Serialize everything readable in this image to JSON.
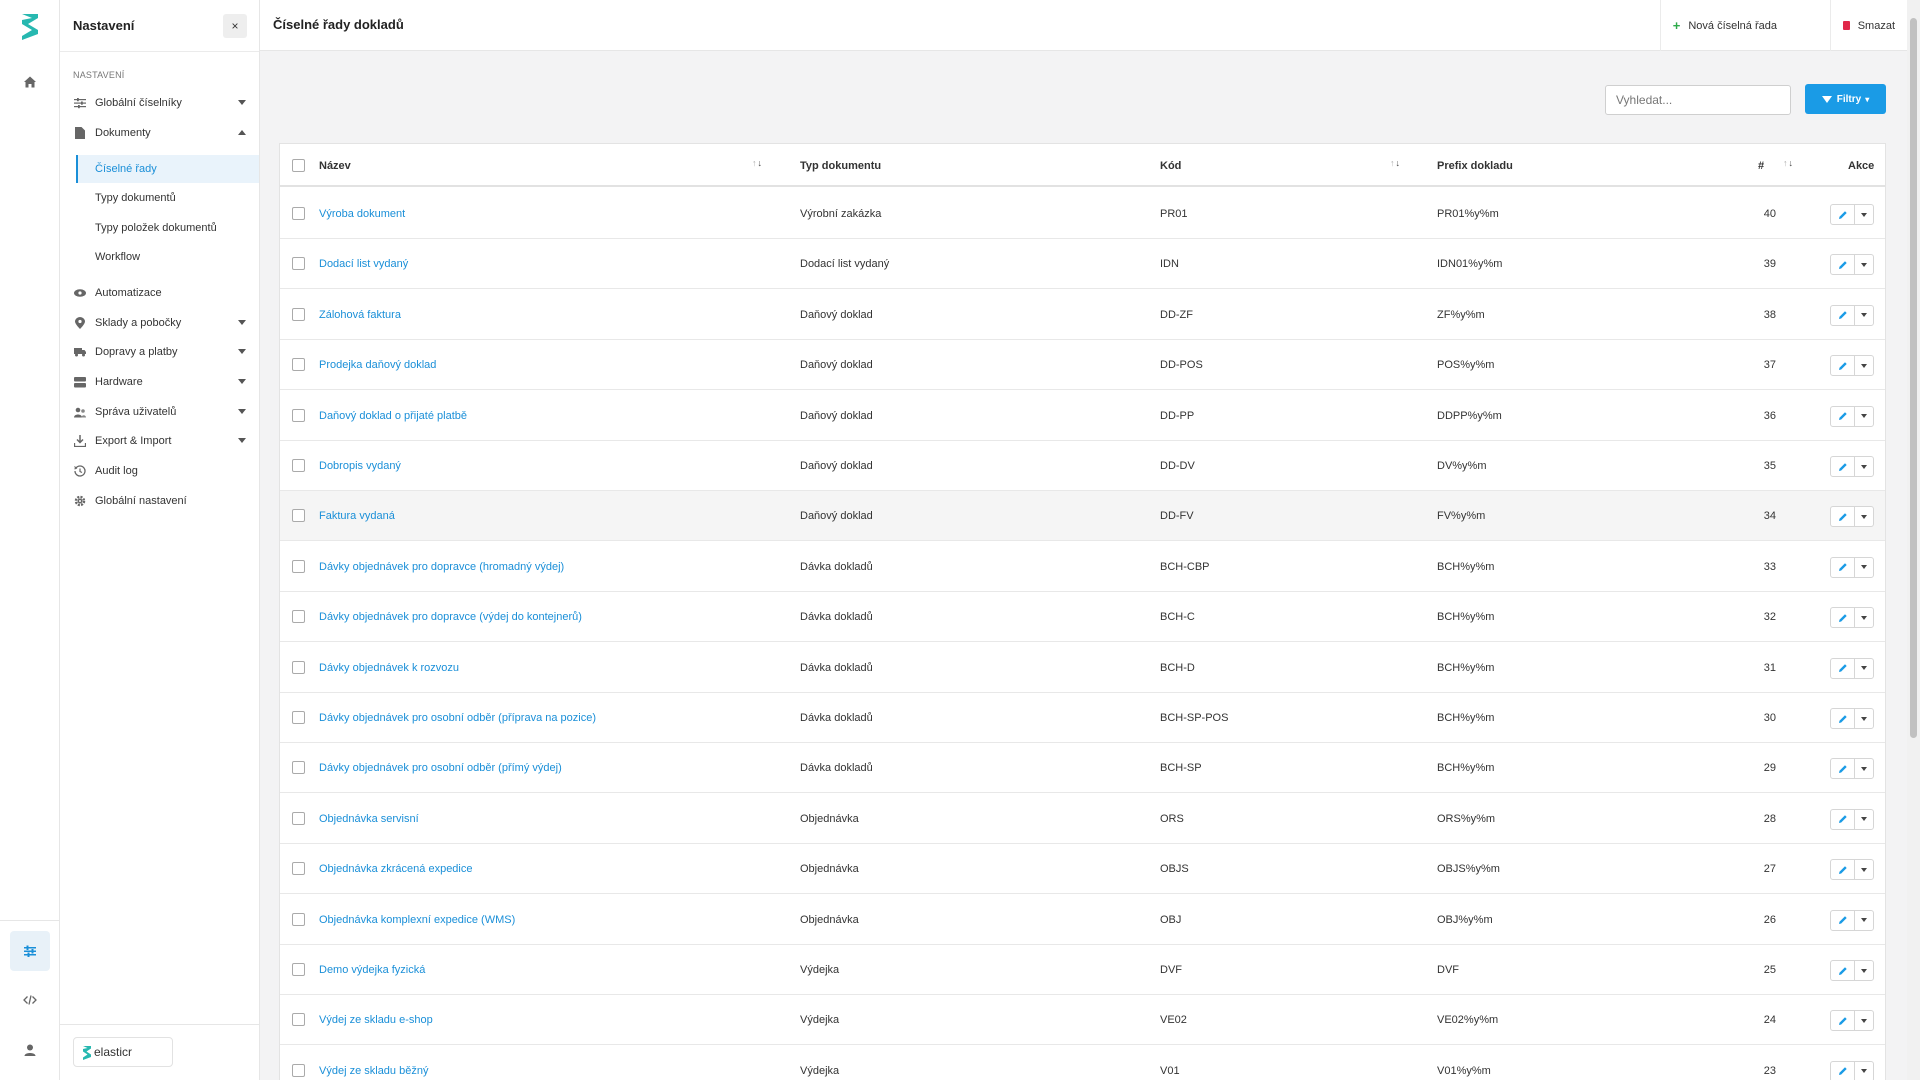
{
  "app": {
    "accent": "#1a9be6",
    "brand_color": "#27b8b0",
    "brand_name": "elasticr"
  },
  "rail": {
    "icons": [
      "logo-icon",
      "home-icon",
      "sliders-icon",
      "code-icon",
      "user-icon"
    ]
  },
  "sidebar": {
    "title": "Nastavení",
    "close_label": "×",
    "section_label": "NASTAVENÍ",
    "items": [
      {
        "label": "Globální číselníky",
        "icon": "sliders-icon"
      },
      {
        "label": "Dokumenty",
        "icon": "document-icon"
      },
      {
        "label": "Automatizace",
        "icon": "eye-icon"
      },
      {
        "label": "Sklady a pobočky",
        "icon": "pin-icon"
      },
      {
        "label": "Dopravy a platby",
        "icon": "truck-icon"
      },
      {
        "label": "Hardware",
        "icon": "server-icon"
      },
      {
        "label": "Správa uživatelů",
        "icon": "users-icon"
      },
      {
        "label": "Export & Import",
        "icon": "download-icon"
      },
      {
        "label": "Audit log",
        "icon": "history-icon"
      },
      {
        "label": "Globální nastavení",
        "icon": "gear-icon"
      }
    ],
    "sub_items": [
      {
        "label": "Číselné řady"
      },
      {
        "label": "Typy dokumentů"
      },
      {
        "label": "Typy položek dokumentů"
      },
      {
        "label": "Workflow"
      }
    ]
  },
  "header": {
    "title": "Číselné řady dokladů",
    "new_label": "Nová číselná řada",
    "delete_label": "Smazat"
  },
  "toolbar": {
    "search_placeholder": "Vyhledat...",
    "filter_label": "Filtry"
  },
  "table": {
    "columns": {
      "name": "Název",
      "doc_type": "Typ dokumentu",
      "code": "Kód",
      "prefix": "Prefix dokladu",
      "number": "#",
      "actions": "Akce"
    },
    "rows": [
      {
        "name": "Výroba dokument",
        "doc_type": "Výrobní zakázka",
        "code": "PR01",
        "prefix": "PR01%y%m",
        "number": "40"
      },
      {
        "name": "Dodací list vydaný",
        "doc_type": "Dodací list vydaný",
        "code": "IDN",
        "prefix": "IDN01%y%m",
        "number": "39"
      },
      {
        "name": "Zálohová faktura",
        "doc_type": "Daňový doklad",
        "code": "DD-ZF",
        "prefix": "ZF%y%m",
        "number": "38"
      },
      {
        "name": "Prodejka daňový doklad",
        "doc_type": "Daňový doklad",
        "code": "DD-POS",
        "prefix": "POS%y%m",
        "number": "37"
      },
      {
        "name": "Daňový doklad o přijaté platbě",
        "doc_type": "Daňový doklad",
        "code": "DD-PP",
        "prefix": "DDPP%y%m",
        "number": "36"
      },
      {
        "name": "Dobropis vydaný",
        "doc_type": "Daňový doklad",
        "code": "DD-DV",
        "prefix": "DV%y%m",
        "number": "35"
      },
      {
        "name": "Faktura vydaná",
        "doc_type": "Daňový doklad",
        "code": "DD-FV",
        "prefix": "FV%y%m",
        "number": "34"
      },
      {
        "name": "Dávky objednávek pro dopravce (hromadný výdej)",
        "doc_type": "Dávka dokladů",
        "code": "BCH-CBP",
        "prefix": "BCH%y%m",
        "number": "33"
      },
      {
        "name": "Dávky objednávek pro dopravce (výdej do kontejnerů)",
        "doc_type": "Dávka dokladů",
        "code": "BCH-C",
        "prefix": "BCH%y%m",
        "number": "32"
      },
      {
        "name": "Dávky objednávek k rozvozu",
        "doc_type": "Dávka dokladů",
        "code": "BCH-D",
        "prefix": "BCH%y%m",
        "number": "31"
      },
      {
        "name": "Dávky objednávek pro osobní odběr (příprava na pozice)",
        "doc_type": "Dávka dokladů",
        "code": "BCH-SP-POS",
        "prefix": "BCH%y%m",
        "number": "30"
      },
      {
        "name": "Dávky objednávek pro osobní odběr (přímý výdej)",
        "doc_type": "Dávka dokladů",
        "code": "BCH-SP",
        "prefix": "BCH%y%m",
        "number": "29"
      },
      {
        "name": "Objednávka servisní",
        "doc_type": "Objednávka",
        "code": "ORS",
        "prefix": "ORS%y%m",
        "number": "28"
      },
      {
        "name": "Objednávka zkrácená expedice",
        "doc_type": "Objednávka",
        "code": "OBJS",
        "prefix": "OBJS%y%m",
        "number": "27"
      },
      {
        "name": "Objednávka komplexní expedice (WMS)",
        "doc_type": "Objednávka",
        "code": "OBJ",
        "prefix": "OBJ%y%m",
        "number": "26"
      },
      {
        "name": "Demo výdejka fyzická",
        "doc_type": "Výdejka",
        "code": "DVF",
        "prefix": "DVF",
        "number": "25"
      },
      {
        "name": "Výdej ze skladu e-shop",
        "doc_type": "Výdejka",
        "code": "VE02",
        "prefix": "VE02%y%m",
        "number": "24"
      },
      {
        "name": "Výdej ze skladu běžný",
        "doc_type": "Výdejka",
        "code": "V01",
        "prefix": "V01%y%m",
        "number": "23"
      }
    ]
  }
}
